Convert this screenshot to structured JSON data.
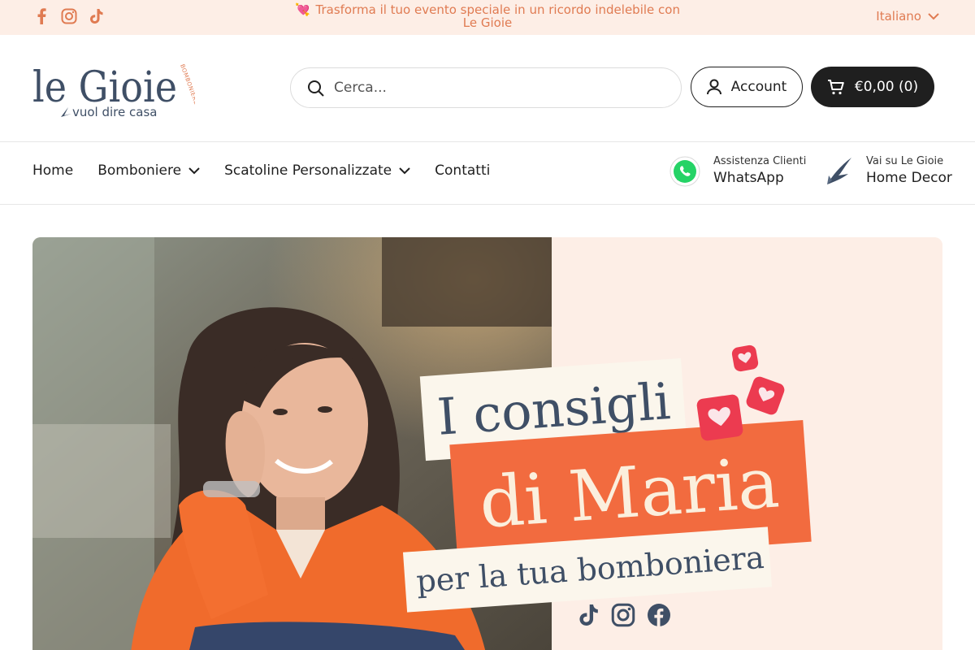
{
  "announcement": {
    "text": "Trasforma il tuo evento speciale in un ricordo indelebile con Le Gioie",
    "heart": "💘"
  },
  "language": {
    "label": "Italiano"
  },
  "social_icons": [
    "facebook-icon",
    "instagram-icon",
    "tiktok-icon"
  ],
  "logo": {
    "name": "le Gioie",
    "side": "BOMBONIERE",
    "tagline": "vuol dire casa"
  },
  "search": {
    "placeholder": "Cerca..."
  },
  "account": {
    "label": "Account"
  },
  "cart": {
    "label": "€0,00 (0)"
  },
  "nav": {
    "items": [
      {
        "label": "Home",
        "dropdown": false
      },
      {
        "label": "Bomboniere",
        "dropdown": true
      },
      {
        "label": "Scatoline Personalizzate",
        "dropdown": true
      },
      {
        "label": "Contatti",
        "dropdown": false
      }
    ]
  },
  "promos": [
    {
      "small": "Assistenza Clienti",
      "big": "WhatsApp",
      "icon": "whatsapp-icon"
    },
    {
      "small": "Vai su Le Gioie",
      "big": "Home Decor",
      "icon": "swallow-logo-icon"
    }
  ],
  "hero": {
    "line1": "I consigli",
    "line2": "di Maria",
    "line3": "per la tua bomboniera"
  },
  "colors": {
    "topbar_bg": "#fdeee6",
    "accent_orange": "#e07b52",
    "hero_orange": "#f26b3f",
    "navy": "#3f4f66",
    "dark": "#1f1f1f"
  }
}
